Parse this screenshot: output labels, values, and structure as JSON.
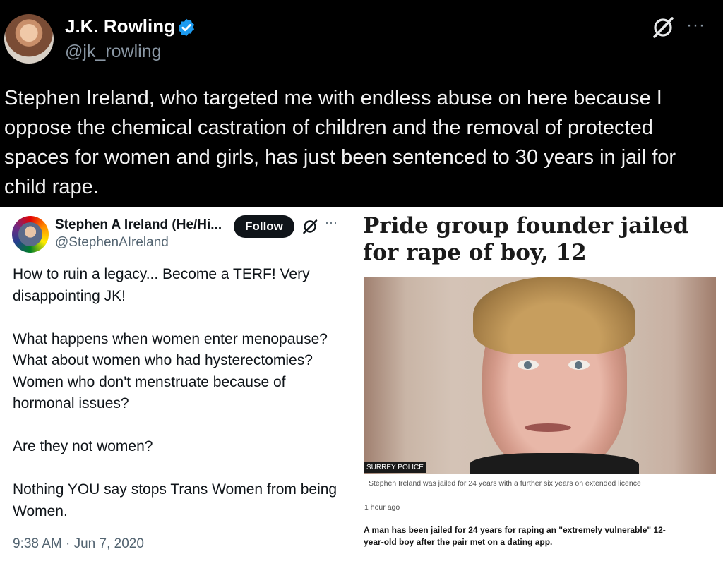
{
  "tweet": {
    "author_name": "J.K. Rowling",
    "author_handle": "@jk_rowling",
    "more_label": "···",
    "text": "Stephen Ireland, who targeted me with endless abuse on here because I oppose the chemical castration of children and the removal of protected spaces for women and girls, has just been sentenced to 30 years in jail for child rape."
  },
  "quoted_tweet": {
    "author_name": "Stephen A Ireland (He/Hi...",
    "author_handle": "@StephenAIreland",
    "follow_label": "Follow",
    "more_label": "···",
    "text": "How to ruin a legacy... Become a TERF! Very disappointing JK!\n\nWhat happens when women enter menopause? What about women who had hysterectomies? Women who don't menstruate because of hormonal issues?\n\nAre they not women?\n\nNothing YOU say stops Trans Women from being Women.",
    "timestamp": "9:38 AM · Jun 7, 2020"
  },
  "article": {
    "headline": "Pride group founder jailed for rape of boy, 12",
    "photo_credit": "SURREY POLICE",
    "photo_caption": "Stephen Ireland was jailed for 24 years with a further six years on extended licence",
    "time_ago": "1 hour ago",
    "lede": "A man has been jailed for 24 years for raping an \"extremely vulnerable\" 12-year-old boy after the pair met on a dating app."
  },
  "colors": {
    "verified_badge": "#1d9bf0",
    "dark_background": "#000000",
    "follow_button": "#0f1419"
  }
}
